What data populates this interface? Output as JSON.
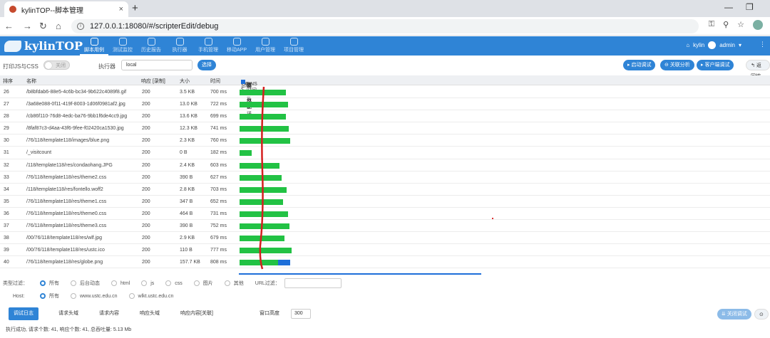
{
  "browser": {
    "tab_title": "kylinTOP--脚本管理",
    "tab_close": "×",
    "new_tab": "+",
    "url": "127.0.0.1:18080/#/scripterEdit/debug"
  },
  "app": {
    "logo_text": "kylinTOP",
    "menu": [
      {
        "label": "脚本用例",
        "active": true
      },
      {
        "label": "测试监控",
        "active": false
      },
      {
        "label": "历史报告",
        "active": false
      },
      {
        "label": "执行器",
        "active": false
      },
      {
        "label": "手机管理",
        "active": false
      },
      {
        "label": "移动APP",
        "active": false
      },
      {
        "label": "用户管理",
        "active": false
      },
      {
        "label": "项目管理",
        "active": false
      }
    ],
    "user_org": "kylin",
    "user_name": "admin"
  },
  "toolbar": {
    "print_label": "打印JS与CSS",
    "toggle_text": "关闭",
    "executor_label": "执行器",
    "executor_value": "local",
    "select_button": "选择",
    "start_debug": "启动调试",
    "relation_analysis": "关联分析",
    "client_debug": "客户端调试",
    "back": "返回编"
  },
  "table": {
    "headers": {
      "index": "排序",
      "name": "名称",
      "response": "响应 [录制]",
      "size": "大小",
      "time": "时间",
      "total": "总时间：",
      "total_value": "7.6 s"
    },
    "legend": [
      {
        "label": "DNS时间",
        "color": "#e5d435"
      },
      {
        "label": "连接与发送",
        "color": "#7b2fa8"
      },
      {
        "label": "首个数据",
        "color": "#22c244"
      },
      {
        "label": "剩余数据",
        "color": "#1e6fd9"
      }
    ],
    "rows": [
      {
        "idx": "26",
        "name": "/b8bfdab6-88e5-4c6b-bc34-9b622c4089f8.gif",
        "status": "200",
        "size": "3.5 KB",
        "time": "700 ms",
        "ms": 700,
        "rest_ms": 0
      },
      {
        "idx": "27",
        "name": "/3a68e088-0f11-419f-8003-1d06f0981af2.jpg",
        "status": "200",
        "size": "13.0 KB",
        "time": "722 ms",
        "ms": 722,
        "rest_ms": 0
      },
      {
        "idx": "28",
        "name": "/cb86f110-76d8-4edc-ba76-9bb1f6de4cc9.jpg",
        "status": "200",
        "size": "13.6 KB",
        "time": "699 ms",
        "ms": 699,
        "rest_ms": 0
      },
      {
        "idx": "29",
        "name": "/8faf87c3-d4aa-43f6-9fee-f02420ca1530.jpg",
        "status": "200",
        "size": "12.3 KB",
        "time": "741 ms",
        "ms": 741,
        "rest_ms": 0
      },
      {
        "idx": "30",
        "name": "/76/118/template118/images/blue.png",
        "status": "200",
        "size": "2.3 KB",
        "time": "760 ms",
        "ms": 760,
        "rest_ms": 0
      },
      {
        "idx": "31",
        "name": "/_visitcount",
        "status": "200",
        "size": "0 B",
        "time": "182 ms",
        "ms": 182,
        "rest_ms": 0
      },
      {
        "idx": "32",
        "name": "/118/template118/res/condaohang.JPG",
        "status": "200",
        "size": "2.4 KB",
        "time": "603 ms",
        "ms": 603,
        "rest_ms": 0
      },
      {
        "idx": "33",
        "name": "/76/118/template118/res/theme2.css",
        "status": "200",
        "size": "390 B",
        "time": "627 ms",
        "ms": 627,
        "rest_ms": 0
      },
      {
        "idx": "34",
        "name": "/118/template118/res/fontello.woff2",
        "status": "200",
        "size": "2.8 KB",
        "time": "703 ms",
        "ms": 703,
        "rest_ms": 0
      },
      {
        "idx": "35",
        "name": "/76/118/template118/res/theme1.css",
        "status": "200",
        "size": "347 B",
        "time": "652 ms",
        "ms": 652,
        "rest_ms": 0
      },
      {
        "idx": "36",
        "name": "/76/118/template118/res/theme0.css",
        "status": "200",
        "size": "464 B",
        "time": "731 ms",
        "ms": 731,
        "rest_ms": 0
      },
      {
        "idx": "37",
        "name": "/76/118/template118/res/theme3.css",
        "status": "200",
        "size": "390 B",
        "time": "752 ms",
        "ms": 752,
        "rest_ms": 0
      },
      {
        "idx": "38",
        "name": "/00/76/118/template118/res/wlf.jpg",
        "status": "200",
        "size": "2.9 KB",
        "time": "679 ms",
        "ms": 679,
        "rest_ms": 0
      },
      {
        "idx": "39",
        "name": "/00/76/118/template118/res/ustc.ico",
        "status": "200",
        "size": "110 B",
        "time": "777 ms",
        "ms": 777,
        "rest_ms": 0
      },
      {
        "idx": "40",
        "name": "/76/118/template118/res/globe.png",
        "status": "200",
        "size": "157.7 KB",
        "time": "808 ms",
        "ms": 578,
        "rest_ms": 180
      }
    ]
  },
  "filters": {
    "type_label": "类型过滤：",
    "types": [
      {
        "label": "所有",
        "checked": true
      },
      {
        "label": "后台动态",
        "checked": false
      },
      {
        "label": "html",
        "checked": false
      },
      {
        "label": "js",
        "checked": false
      },
      {
        "label": "css",
        "checked": false
      },
      {
        "label": "图片",
        "checked": false
      },
      {
        "label": "其他",
        "checked": false
      }
    ],
    "url_filter_label": "URL过滤：",
    "host_label": "Host:",
    "hosts": [
      {
        "label": "所有",
        "checked": true
      },
      {
        "label": "www.ustc.edu.cn",
        "checked": false
      },
      {
        "label": "wlkt.ustc.edu.cn",
        "checked": false
      }
    ]
  },
  "bottom": {
    "tabs": [
      "调试日志",
      "请求头域",
      "请求内容",
      "响应头域",
      "响应内容[关联]"
    ],
    "window_height_label": "窗口高度",
    "window_height_value": "300",
    "hint_button": "关闭调试",
    "status": "执行成功, 请求个数: 41, 响应个数: 41, 总吞吐量: 5.13 Mb"
  }
}
